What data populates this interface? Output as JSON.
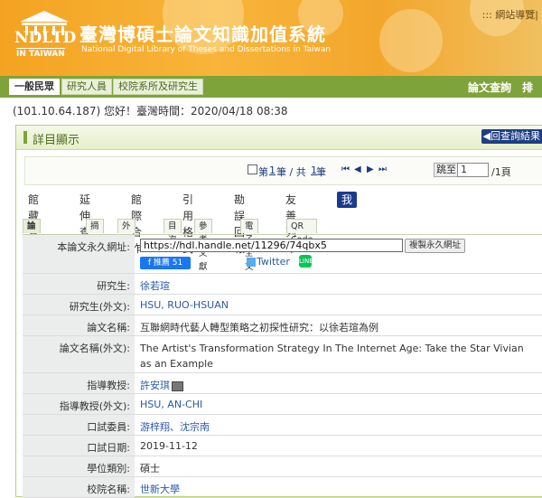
{
  "header": {
    "logo_text": "NDLTD",
    "logo_sub": "IN TAIWAN",
    "title": "臺灣博碩士論文知識加值系統",
    "subtitle": "National Digital Library of Theses and Dissertations in Taiwan",
    "nav_link": "::: 網站導覽|"
  },
  "navbar": {
    "tabs": [
      "一般民眾",
      "研究人員",
      "校院系所及研究生"
    ],
    "right_links": [
      "論文查詢",
      "排行"
    ]
  },
  "status_line": "(101.10.64.187) 您好！臺灣時間：2020/04/18 08:38",
  "panel": {
    "title": "詳目顯示",
    "back_button": "回查詢結果",
    "pager": {
      "current_prefix": "第 ",
      "current": "1",
      "current_suffix": " 筆 / 共 ",
      "total": "1",
      "total_suffix": " 筆",
      "jump_label": "跳至",
      "page_value": "1",
      "page_total": "/1頁"
    },
    "actions": [
      "館藏查詢",
      "延伸查詢",
      "館際合作",
      "引用格式",
      "勘誤回報",
      "友善列印",
      "我願授權"
    ],
    "tabs": [
      "論文基本資料",
      "摘要",
      "外文摘要",
      "目次",
      "參考文獻",
      "電子全文",
      "QR Code"
    ],
    "permalink": {
      "label": "本論文永久網址:",
      "url": "https://hdl.handle.net/11296/74qbx5",
      "copy_label": "複製永久網址",
      "fb_label": "f 推薦 51",
      "twitter_label": "Twitter",
      "line_label": "LINE"
    },
    "fields": [
      {
        "label": "研究生:",
        "value": "徐若瑄",
        "link": true
      },
      {
        "label": "研究生(外文):",
        "value": "HSU, RUO-HSUAN",
        "link": true
      },
      {
        "label": "論文名稱:",
        "value": "互聯網時代藝人轉型策略之初探性研究：以徐若瑄為例",
        "link": false
      },
      {
        "label": "論文名稱(外文):",
        "value": "The Artist's Transformation Strategy In The Internet Age: Take the Star Vivian as an Example",
        "link": false
      },
      {
        "label": "指導教授:",
        "value": "許安琪",
        "link": true
      },
      {
        "label": "指導教授(外文):",
        "value": "HSU, AN-CHI",
        "link": true
      },
      {
        "label": "口試委員:",
        "value": "游梓翔、沈宗南",
        "link": true
      },
      {
        "label": "口試日期:",
        "value": "2019-11-12",
        "link": false
      },
      {
        "label": "學位類別:",
        "value": "碩士",
        "link": false
      },
      {
        "label": "校院名稱:",
        "value": "世新大學",
        "link": true
      }
    ]
  },
  "colors": {
    "header_orange": "#f4a321",
    "nav_green": "#7ea33a",
    "action_blue": "#1c3a8c",
    "link_blue": "#2b58a6"
  }
}
